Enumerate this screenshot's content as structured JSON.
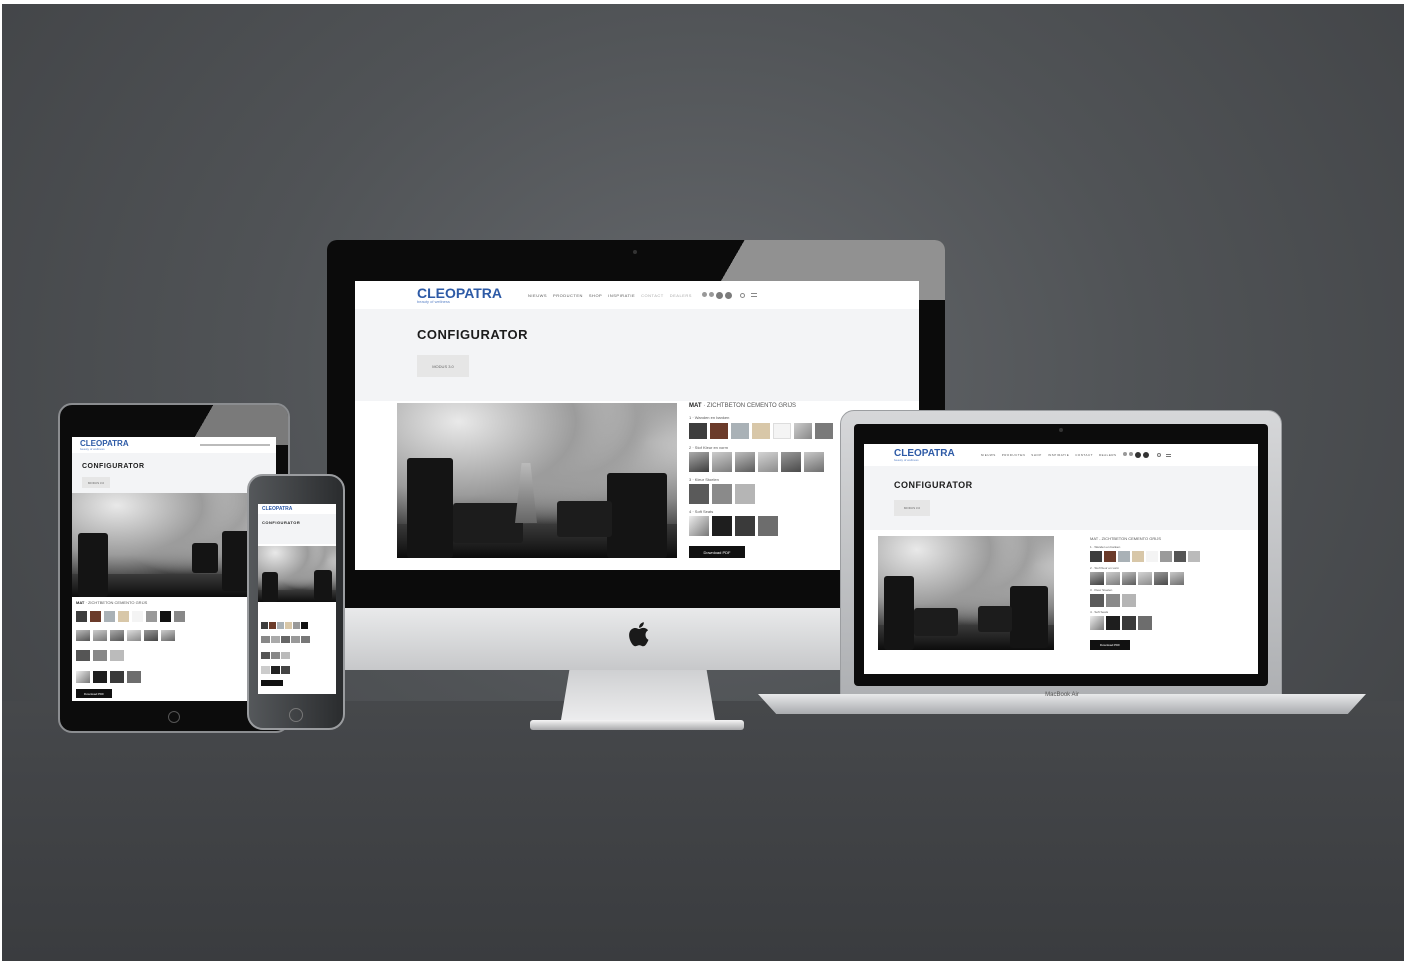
{
  "brand": {
    "name": "CLEOPATRA",
    "tagline": "beauty of wellness"
  },
  "nav_desktop": [
    "NIEUWS",
    "PRODUCTEN",
    "SHOP",
    "INSPIRATIE",
    "CONTACT",
    "DEALERS"
  ],
  "nav_laptop": [
    "NIEUWS",
    "PRODUCTEN",
    "SHOP",
    "INSPIRATIE",
    "CONTACT",
    "DEALERS"
  ],
  "page": {
    "title": "CONFIGURATOR",
    "button": "MODUS 3.0",
    "button_small": "MODUS 3.0",
    "download": "Download PDF"
  },
  "material": {
    "prefix": "MAT",
    "name": "ZICHTBETON CEMENTO GRIJS",
    "full": "MAT - ZICHTBETON CEMENTO GRIJS"
  },
  "options": [
    {
      "label": "1 · Wanden en banken"
    },
    {
      "label": "2 · Stof Kleur en vorm"
    },
    {
      "label": "3 · Kleur Stoelen"
    },
    {
      "label": "4 · Soft Seats"
    }
  ],
  "devices": {
    "laptop_label": "MacBook Air"
  },
  "colors": {
    "brand_blue": "#2d5aa6",
    "background": "#4f5255",
    "black": "#111111"
  },
  "icons": [
    "apple-logo-icon",
    "search-icon",
    "menu-icon",
    "home-button-icon",
    "camera-icon"
  ]
}
